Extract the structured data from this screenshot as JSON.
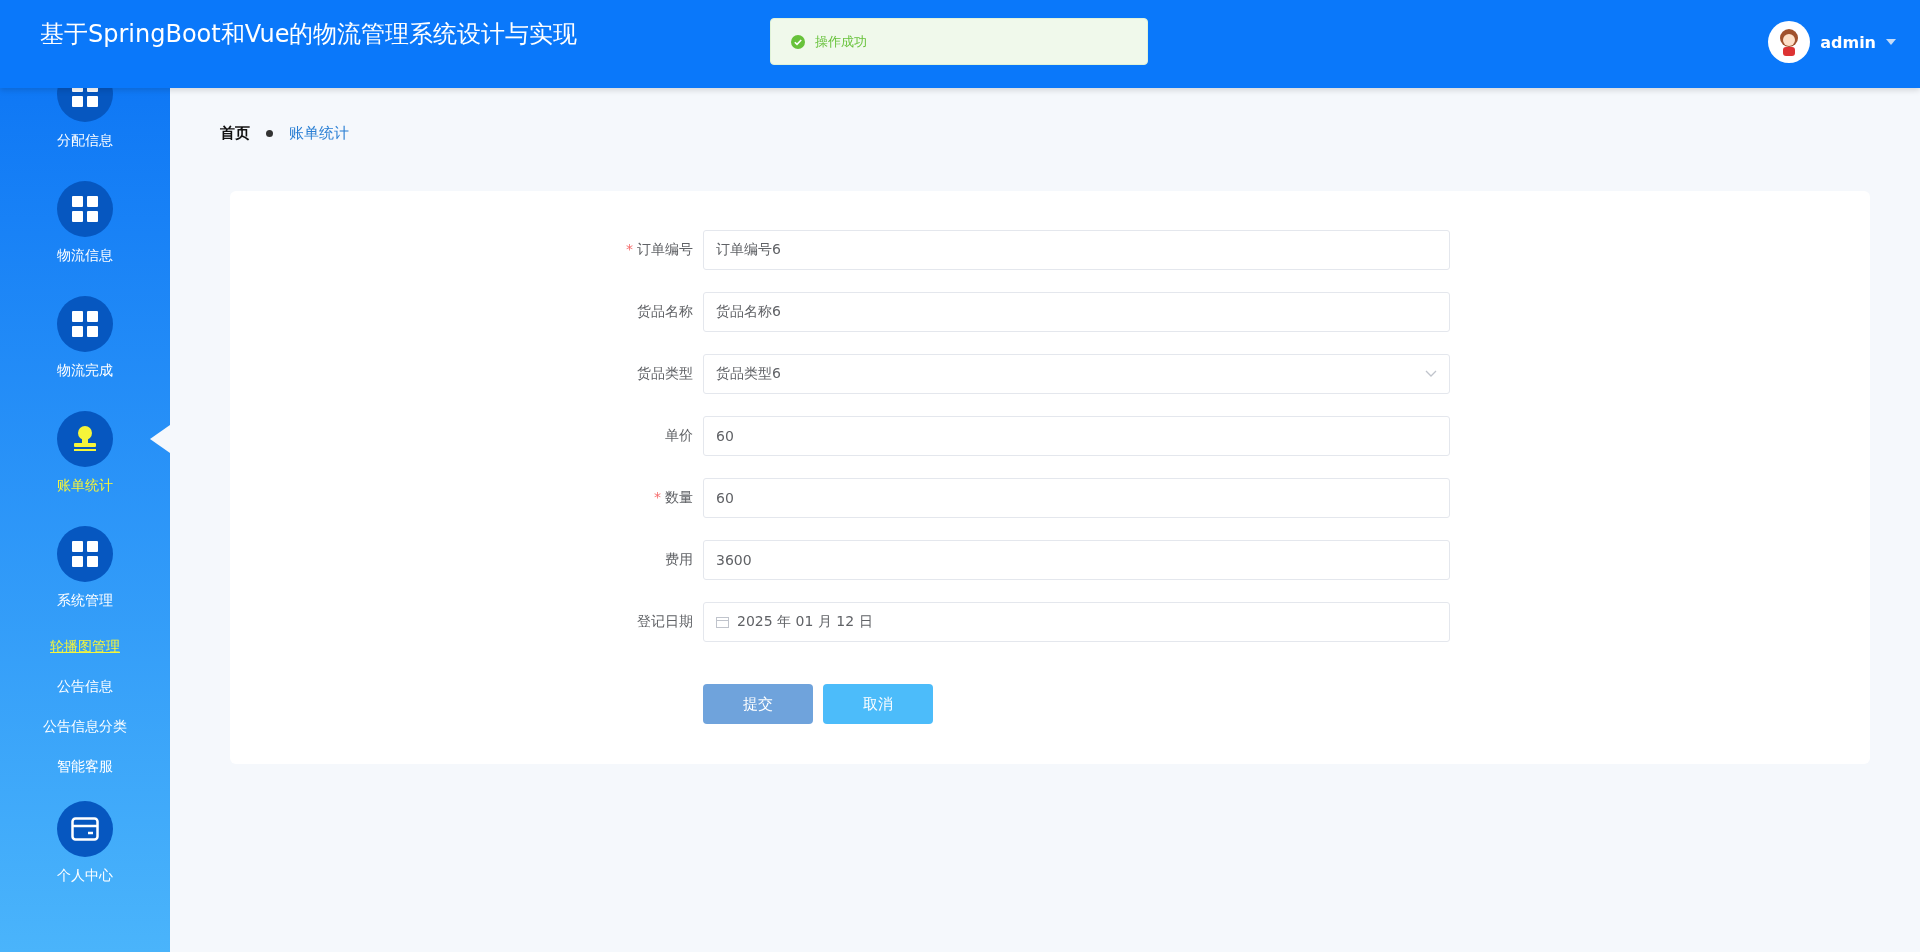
{
  "header": {
    "title": "基于SpringBoot和Vue的物流管理系统设计与实现",
    "toast": {
      "message": "操作成功"
    },
    "user": {
      "name": "admin"
    }
  },
  "sidebar": {
    "items": [
      {
        "label": "分配信息",
        "selected": false
      },
      {
        "label": "物流信息",
        "selected": false
      },
      {
        "label": "物流完成",
        "selected": false
      },
      {
        "label": "账单统计",
        "selected": true
      },
      {
        "label": "系统管理",
        "selected": false,
        "children": [
          {
            "label": "轮播图管理",
            "highlighted": true
          },
          {
            "label": "公告信息",
            "highlighted": false
          },
          {
            "label": "公告信息分类",
            "highlighted": false
          },
          {
            "label": "智能客服",
            "highlighted": false
          }
        ]
      },
      {
        "label": "个人中心",
        "selected": false
      }
    ]
  },
  "breadcrumb": [
    {
      "label": "首页",
      "current": false
    },
    {
      "label": "账单统计",
      "current": true
    }
  ],
  "form": {
    "fields": [
      {
        "label": "订单编号",
        "kind": "text",
        "required_mark": "*",
        "value": "订单编号6"
      },
      {
        "label": "货品名称",
        "kind": "text",
        "value": "货品名称6"
      },
      {
        "label": "货品类型",
        "kind": "select",
        "value": "货品类型6"
      },
      {
        "label": "单价",
        "kind": "text",
        "value": "60"
      },
      {
        "label": "数量",
        "kind": "text",
        "required_mark": "*",
        "value": "60"
      },
      {
        "label": "费用",
        "kind": "text",
        "value": "3600"
      },
      {
        "label": "登记日期",
        "kind": "date",
        "value": "2025 年 01 月 12 日"
      }
    ],
    "buttons": [
      {
        "label": "提交",
        "kind": "primary"
      },
      {
        "label": "取消",
        "kind": "secondary"
      }
    ]
  }
}
